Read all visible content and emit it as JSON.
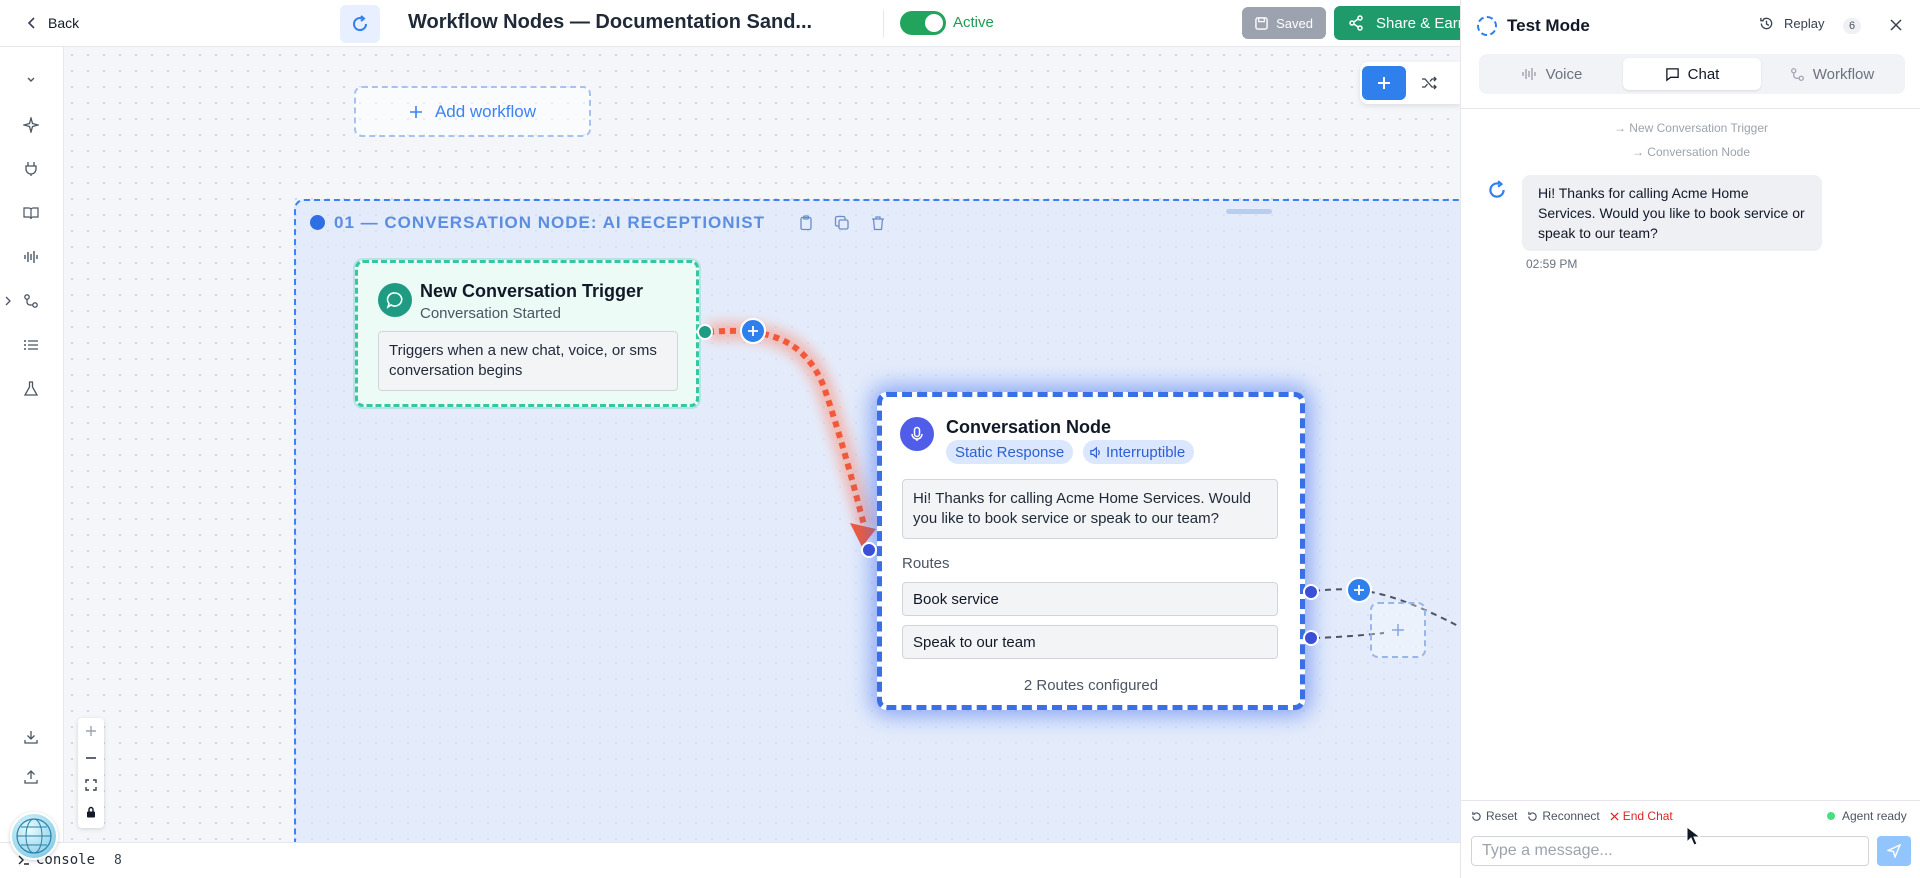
{
  "header": {
    "back_label": "Back",
    "title": "Workflow Nodes — Documentation Sand...",
    "status_label": "Active",
    "saved_label": "Saved",
    "share_label": "Share & Earn"
  },
  "canvas": {
    "add_workflow_label": "Add workflow",
    "group": {
      "title": "01 — CONVERSATION NODE: AI RECEPTIONIST"
    },
    "trigger_node": {
      "title": "New Conversation Trigger",
      "subtitle": "Conversation Started",
      "description": "Triggers when a new chat, voice, or sms conversation begins"
    },
    "conversation_node": {
      "title": "Conversation Node",
      "badges": [
        "Static Response",
        "Interruptible"
      ],
      "message": "Hi! Thanks for calling Acme Home Services. Would you like to book service or speak to our team?",
      "routes_label": "Routes",
      "routes": [
        "Book service",
        "Speak to our team"
      ],
      "routes_count": "2 Routes configured"
    }
  },
  "console": {
    "label": "Console",
    "count": "8"
  },
  "panel": {
    "title": "Test Mode",
    "replay_label": "Replay",
    "replay_count": "6",
    "tabs": [
      {
        "label": "Voice",
        "active": false
      },
      {
        "label": "Chat",
        "active": true
      },
      {
        "label": "Workflow",
        "active": false
      }
    ],
    "trace": [
      "→ New Conversation Trigger",
      "→ Conversation Node"
    ],
    "message": {
      "text": "Hi! Thanks for calling Acme Home Services. Would you like to book service or speak to our team?",
      "time": "02:59 PM"
    },
    "actions": {
      "reset": "Reset",
      "reconnect": "Reconnect",
      "end_chat": "End Chat"
    },
    "agent_status": "Agent ready",
    "input_placeholder": "Type a message..."
  },
  "colors": {
    "accent": "#2f80ed",
    "active_green": "#22a45d",
    "trigger_teal": "#34c7a0",
    "conversation_blue": "#3b6fe6",
    "edge_orange": "#f05a3a"
  }
}
